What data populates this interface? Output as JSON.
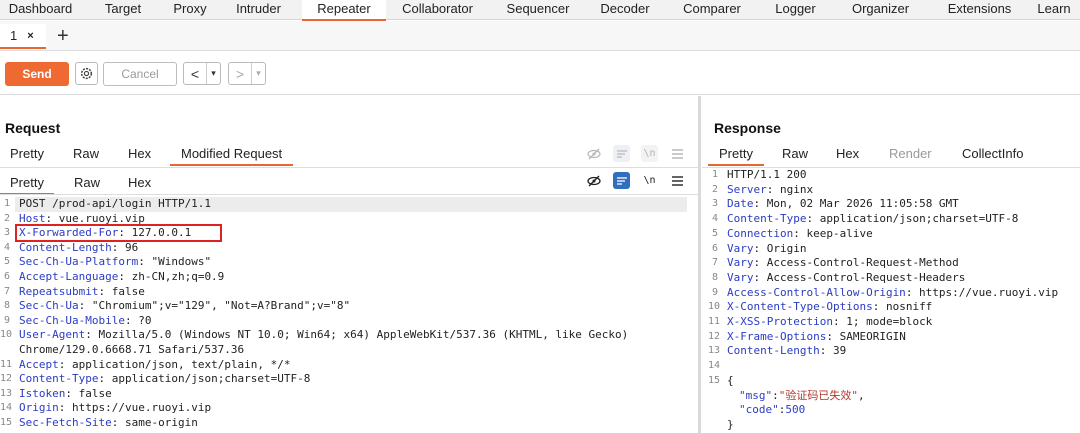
{
  "nav": {
    "tabs": [
      {
        "label": "Dashboard",
        "active": false
      },
      {
        "label": "Target",
        "active": false
      },
      {
        "label": "Proxy",
        "active": false
      },
      {
        "label": "Intruder",
        "active": false
      },
      {
        "label": "Repeater",
        "active": true
      },
      {
        "label": "Collaborator",
        "active": false
      },
      {
        "label": "Sequencer",
        "active": false
      },
      {
        "label": "Decoder",
        "active": false
      },
      {
        "label": "Comparer",
        "active": false
      },
      {
        "label": "Logger",
        "active": false
      },
      {
        "label": "Organizer",
        "active": false
      },
      {
        "label": "Extensions",
        "active": false
      },
      {
        "label": "Learn",
        "active": false
      }
    ]
  },
  "repeater_tab": {
    "label": "1",
    "close": "×",
    "add": "+"
  },
  "toolbar": {
    "send_label": "Send",
    "cancel_label": "Cancel",
    "back": "<",
    "forward": ">",
    "dropdown": "▾"
  },
  "request": {
    "title": "Request",
    "tabs": [
      "Pretty",
      "Raw",
      "Hex",
      "Modified Request"
    ],
    "inner_tabs": [
      "Pretty",
      "Raw",
      "Hex"
    ],
    "icons": [
      "eye-slash",
      "wrap-lines",
      "newline",
      "menu"
    ],
    "newline_label": "\\n",
    "lines": [
      {
        "n": "1",
        "k": "",
        "v": "POST /prod-api/login HTTP/1.1"
      },
      {
        "n": "2",
        "k": "Host",
        "v": " vue.ruoyi.vip"
      },
      {
        "n": "3",
        "k": "X-Forwarded-For",
        "v": " 127.0.0.1"
      },
      {
        "n": "4",
        "k": "Content-Length",
        "v": " 96"
      },
      {
        "n": "5",
        "k": "Sec-Ch-Ua-Platform",
        "v": " \"Windows\""
      },
      {
        "n": "6",
        "k": "Accept-Language",
        "v": " zh-CN,zh;q=0.9"
      },
      {
        "n": "7",
        "k": "Repeatsubmit",
        "v": " false"
      },
      {
        "n": "8",
        "k": "Sec-Ch-Ua",
        "v": " \"Chromium\";v=\"129\", \"Not=A?Brand\";v=\"8\""
      },
      {
        "n": "9",
        "k": "Sec-Ch-Ua-Mobile",
        "v": " ?0"
      },
      {
        "n": "10",
        "k": "User-Agent",
        "v": " Mozilla/5.0 (Windows NT 10.0; Win64; x64) AppleWebKit/537.36 (KHTML, like Gecko)"
      },
      {
        "n": "",
        "k": "",
        "v": "Chrome/129.0.6668.71 Safari/537.36"
      },
      {
        "n": "11",
        "k": "Accept",
        "v": " application/json, text/plain, */*"
      },
      {
        "n": "12",
        "k": "Content-Type",
        "v": " application/json;charset=UTF-8"
      },
      {
        "n": "13",
        "k": "Istoken",
        "v": " false"
      },
      {
        "n": "14",
        "k": "Origin",
        "v": " https://vue.ruoyi.vip"
      },
      {
        "n": "15",
        "k": "Sec-Fetch-Site",
        "v": " same-origin"
      }
    ]
  },
  "response": {
    "title": "Response",
    "tabs": [
      "Pretty",
      "Raw",
      "Hex",
      "Render",
      "CollectInfo"
    ],
    "lines": [
      {
        "n": "1",
        "k": "",
        "v": "HTTP/1.1 200"
      },
      {
        "n": "2",
        "k": "Server",
        "v": " nginx"
      },
      {
        "n": "3",
        "k": "Date",
        "v": " Mon, 02 Mar 2026 11:05:58 GMT"
      },
      {
        "n": "4",
        "k": "Content-Type",
        "v": " application/json;charset=UTF-8"
      },
      {
        "n": "5",
        "k": "Connection",
        "v": " keep-alive"
      },
      {
        "n": "6",
        "k": "Vary",
        "v": " Origin"
      },
      {
        "n": "7",
        "k": "Vary",
        "v": " Access-Control-Request-Method"
      },
      {
        "n": "8",
        "k": "Vary",
        "v": " Access-Control-Request-Headers"
      },
      {
        "n": "9",
        "k": "Access-Control-Allow-Origin",
        "v": " https://vue.ruoyi.vip"
      },
      {
        "n": "10",
        "k": "X-Content-Type-Options",
        "v": " nosniff"
      },
      {
        "n": "11",
        "k": "X-XSS-Protection",
        "v": " 1; mode=block"
      },
      {
        "n": "12",
        "k": "X-Frame-Options",
        "v": " SAMEORIGIN"
      },
      {
        "n": "13",
        "k": "Content-Length",
        "v": " 39"
      },
      {
        "n": "14",
        "k": "",
        "v": ""
      },
      {
        "n": "15",
        "k": "",
        "v": "{"
      }
    ],
    "json_lines": [
      {
        "key": "\"msg\"",
        "sep": ":",
        "val": "\"验证码已失效\"",
        "tail": ",",
        "val_type": "string"
      },
      {
        "key": "\"code\"",
        "sep": ":",
        "val": "500",
        "tail": "",
        "val_type": "number"
      }
    ],
    "json_close": "}"
  },
  "colors": {
    "accent": "#e8662f",
    "send": "#ef6a33",
    "header_key": "#2b3cc4",
    "string_value": "#b3382a",
    "highlight_box": "#dd2222"
  }
}
